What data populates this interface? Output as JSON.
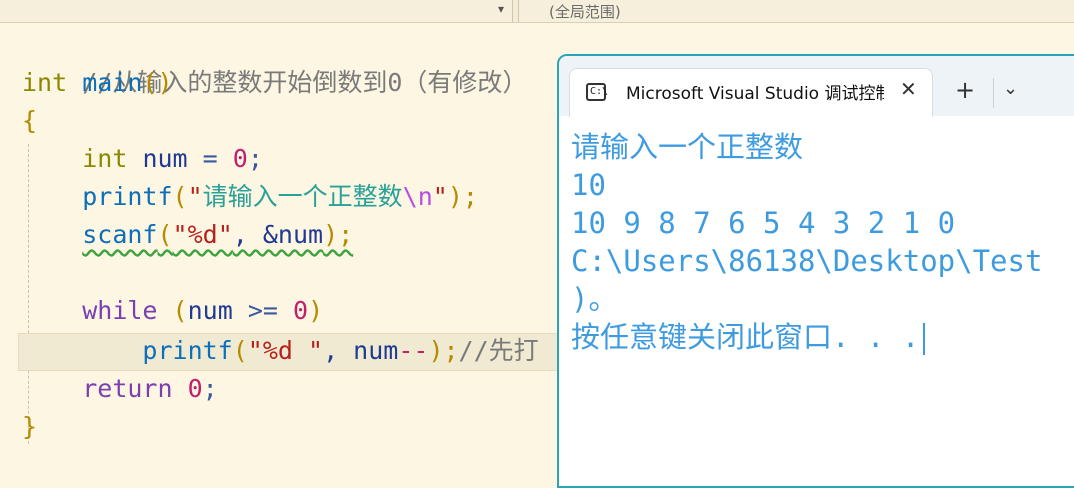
{
  "scope_bar": {
    "right_label": "(全局范围)",
    "left_chevron_icon": "chevron-down-icon"
  },
  "code": {
    "comment_line": "//从输入的整数开始倒数到0（有修改）",
    "l2_type": "int",
    "l2_fn": "main",
    "l2_parens": "()",
    "l3": "{",
    "l4_type": "int",
    "l4_var": "num",
    "l4_eq": "=",
    "l4_num": "0",
    "l4_semi": ";",
    "l5_fn": "printf",
    "l5_open": "(",
    "l5_q1": "\"",
    "l5_text": "请输入一个正整数",
    "l5_esc": "\\n",
    "l5_q2": "\"",
    "l5_close": ");",
    "l6_fn": "scanf",
    "l6_open": "(",
    "l6_str": "\"%d\"",
    "l6_rest": ", &num",
    "l6_close": ");",
    "l8_kw": "while",
    "l8_open": "(",
    "l8_var": "num",
    "l8_op": ">=",
    "l8_num": "0",
    "l8_close": ")",
    "l9_fn": "printf",
    "l9_open": "(",
    "l9_str": "\"%d \"",
    "l9_mid": ", num",
    "l9_op": "--",
    "l9_close": ");",
    "l9_comment": "//先打",
    "l10_kw": "return",
    "l10_num": "0",
    "l10_semi": ";",
    "l11": "}"
  },
  "console": {
    "tab_title": "Microsoft Visual Studio 调试控制台",
    "tab_icon_glyph": "C:\\",
    "close_glyph": "✕",
    "plus_glyph": "+",
    "dropdown_glyph": "⌄",
    "output_lines": [
      "请输入一个正整数",
      "10",
      "10 9 8 7 6 5 4 3 2 1 0",
      "C:\\Users\\86138\\Desktop\\Test",
      ")。",
      "按任意键关闭此窗口. . ."
    ]
  },
  "colors": {
    "editor_bg": "#fdf6e3",
    "console_border": "#2aa4b8",
    "console_text": "#3e9be0"
  }
}
